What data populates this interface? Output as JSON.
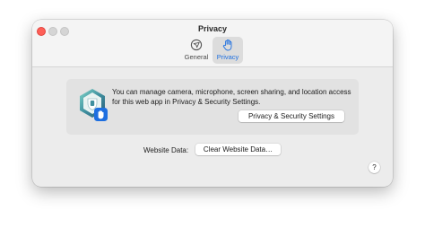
{
  "window": {
    "title": "Privacy"
  },
  "tabs": [
    {
      "label": "General",
      "icon": "compass-icon",
      "selected": false
    },
    {
      "label": "Privacy",
      "icon": "hand-icon",
      "selected": true
    }
  ],
  "privacy_info": {
    "message": "You can manage camera, microphone, screen sharing, and location access for this web app in Privacy & Security Settings.",
    "button_label": "Privacy & Security Settings",
    "icon": "app-shield-icon"
  },
  "website_data": {
    "label": "Website Data:",
    "button_label": "Clear Website Data…"
  },
  "help": {
    "label": "?"
  },
  "colors": {
    "accent": "#1e6fe0",
    "close": "#fe5f57",
    "window_bg": "#ececec"
  }
}
